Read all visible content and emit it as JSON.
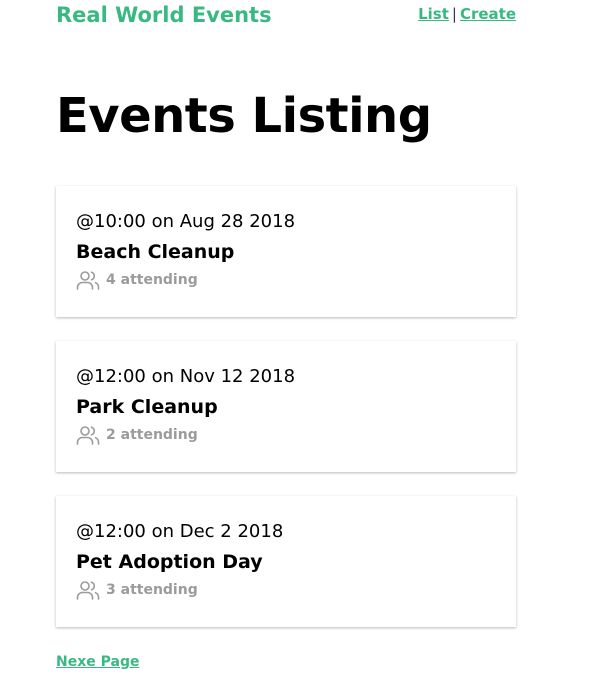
{
  "nav": {
    "brand": "Real World Events",
    "list_link": "List",
    "separator": "|",
    "create_link": "Create"
  },
  "page": {
    "title": "Events Listing"
  },
  "events": [
    {
      "datetime": "@10:00 on Aug 28 2018",
      "title": "Beach Cleanup",
      "attending": "4 attending"
    },
    {
      "datetime": "@12:00 on Nov 12 2018",
      "title": "Park Cleanup",
      "attending": "2 attending"
    },
    {
      "datetime": "@12:00 on Dec 2 2018",
      "title": "Pet Adoption Day",
      "attending": "3 attending"
    }
  ],
  "pagination": {
    "next_label": "Nexe Page"
  },
  "icons": {
    "attendees": "users-icon"
  },
  "colors": {
    "brand": "#39b982",
    "muted_text": "#9b9b9b",
    "title_text": "#000000"
  }
}
